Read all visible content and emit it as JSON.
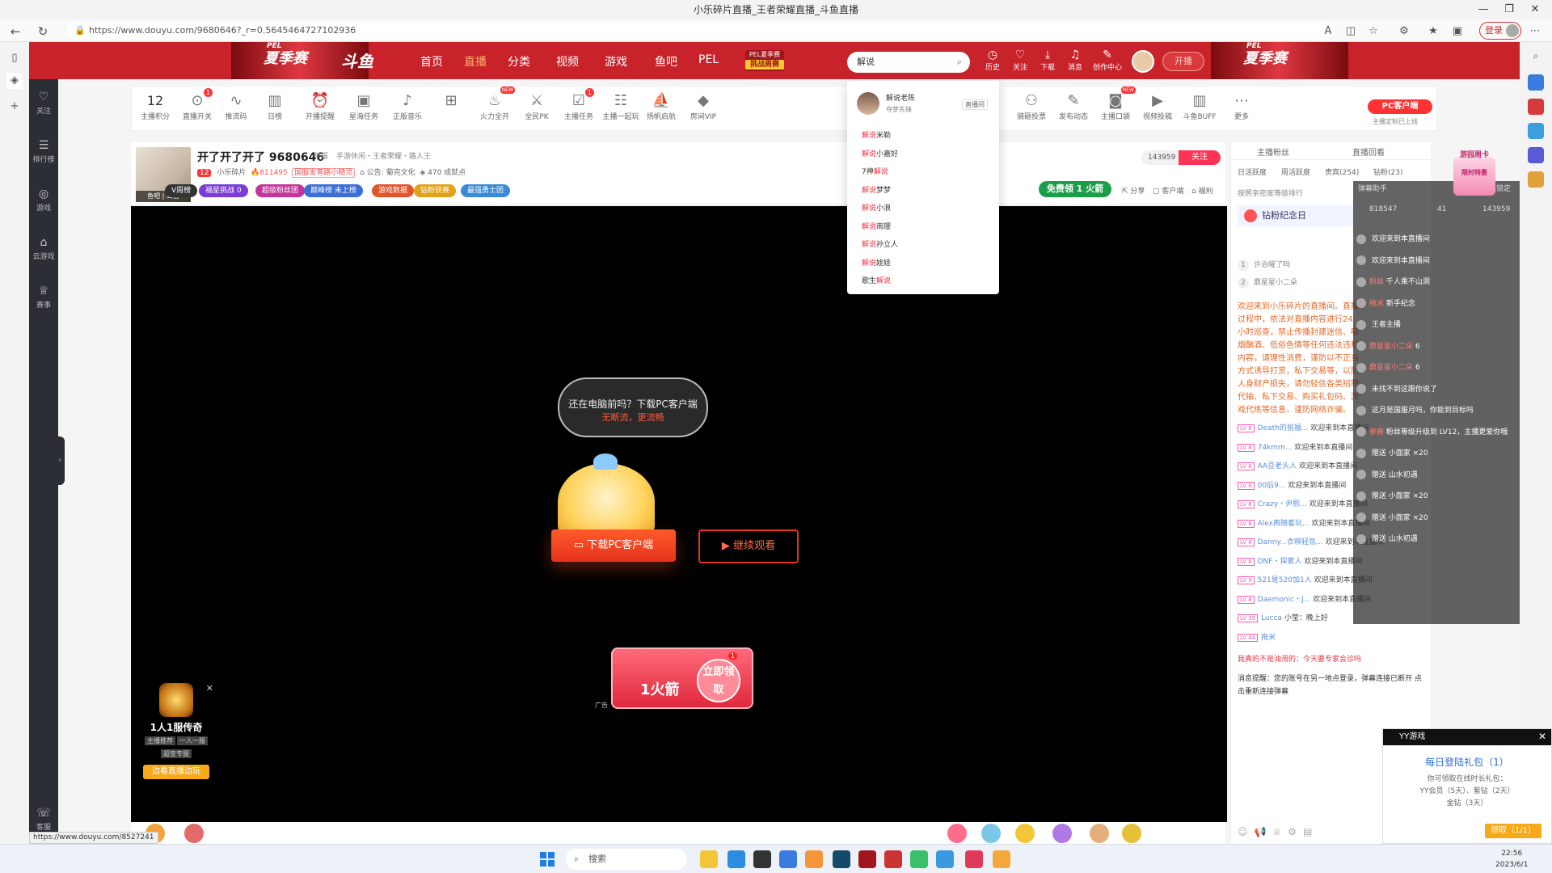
{
  "window": {
    "title": "小乐碎片直播_王者荣耀直播_斗鱼直播",
    "controls": [
      "—",
      "❐",
      "✕"
    ]
  },
  "browser": {
    "url": "https://www.douyu.com/9680646?_r=0.5645464727102936",
    "login_label": "登录",
    "status_url": "https://www.douyu.com/8527241"
  },
  "header": {
    "pel_left": "PEL",
    "pel_left_sub": "夏季赛",
    "pel_right": "PEL",
    "pel_right_sub": "夏季赛",
    "logo": "斗鱼",
    "nav": [
      "首页",
      "直播",
      "分类",
      "视频",
      "游戏",
      "鱼吧",
      "PEL"
    ],
    "pel_badge_top": "PEL夏季赛",
    "pel_badge_bottom": "挑战周赛",
    "search_value": "解说",
    "icons": [
      {
        "label": "历史",
        "icon": "history-icon",
        "glyph": "◷"
      },
      {
        "label": "关注",
        "icon": "heart-icon",
        "glyph": "♡"
      },
      {
        "label": "下载",
        "icon": "download-icon",
        "glyph": "⤓"
      },
      {
        "label": "消息",
        "icon": "bell-icon",
        "glyph": "♫"
      },
      {
        "label": "创作中心",
        "icon": "bulb-icon",
        "glyph": "✎"
      }
    ],
    "start_stream": "开播"
  },
  "dy_sidebar": [
    {
      "label": "关注",
      "glyph": "♡"
    },
    {
      "label": "排行榜",
      "glyph": "☰"
    },
    {
      "label": "游戏",
      "glyph": "◎"
    },
    {
      "label": "云游戏",
      "glyph": "⌂"
    },
    {
      "label": "赛事",
      "glyph": "♕"
    },
    {
      "label": "客服",
      "glyph": "☏"
    }
  ],
  "toolbar": {
    "score": "12",
    "score_label": "主播积分",
    "items": [
      {
        "label": "直播开关",
        "glyph": "⊙",
        "badge": "1"
      },
      {
        "label": "推流码",
        "glyph": "∿"
      },
      {
        "label": "日榜",
        "glyph": "▥"
      },
      {
        "label": "开播提醒",
        "glyph": "⏰"
      },
      {
        "label": "星海任务",
        "glyph": "▣"
      },
      {
        "label": "正版音乐",
        "glyph": "♪"
      },
      {
        "label": "",
        "glyph": "⊞"
      },
      {
        "label": "火力全开",
        "glyph": "♨",
        "new": "NEW"
      },
      {
        "label": "全民PK",
        "glyph": "⚔"
      },
      {
        "label": "主播任务",
        "glyph": "☑",
        "badge": "1"
      },
      {
        "label": "主播一起玩",
        "glyph": "☷"
      },
      {
        "label": "扬帆启航",
        "glyph": "⛵"
      },
      {
        "label": "房间VIP",
        "glyph": "◆"
      }
    ],
    "items_right": [
      {
        "label": "单",
        "glyph": "▦"
      },
      {
        "label": "骑砸投票",
        "glyph": "⚇"
      },
      {
        "label": "发布动态",
        "glyph": "✎"
      },
      {
        "label": "主播口袋",
        "glyph": "◙",
        "new": "NEW"
      },
      {
        "label": "视频投稿",
        "glyph": "▶"
      },
      {
        "label": "斗鱼BUFF",
        "glyph": "▥"
      },
      {
        "label": "更多",
        "glyph": "⋯"
      }
    ],
    "pc_client": "PC客户端",
    "pc_client_sub": "主播定制已上线"
  },
  "room": {
    "title": "开了开了开了 9680646",
    "report": "举报",
    "categories": "手游休闲・王者荣耀・路人王",
    "avatar_caption": "鱼吧 | 公告",
    "level": "12",
    "streamer": "小乐碎片",
    "hot": "811495",
    "help": "国服发育路小精灵",
    "notice": "公告: 菊完文化",
    "fans": "470 成就点",
    "pills": [
      {
        "label": "V周榜",
        "color": "#333333"
      },
      {
        "label": "福星挑战 0",
        "color": "#7a3bd6"
      },
      {
        "label": "超级粉丝团",
        "color": "#c3359a"
      },
      {
        "label": "巅峰榜 未上榜",
        "color": "#3b6fd6"
      },
      {
        "label": "游戏数据",
        "color": "#e0552c"
      },
      {
        "label": "钻粉获赛",
        "color": "#e0a21a"
      },
      {
        "label": "最强勇士团",
        "color": "#3b8ad6"
      }
    ],
    "follow_count": "143959",
    "follow_label": "关注",
    "free_rocket": "免费领 1 火箭",
    "share": "分享",
    "client": "客户端",
    "welfare": "福利"
  },
  "video": {
    "bubble_line1": "还在电脑前吗？下载PC客户端",
    "bubble_line2": "无断流，更流畅",
    "download_btn": "下载PC客户端",
    "watch_btn": "继续观看",
    "rocket_title": "1火箭",
    "rocket_claim": "立即领取",
    "rocket_badge": "1",
    "ad_label": "广告",
    "game_name": "1人1服传奇",
    "game_tags": [
      "主播推荐",
      "一人一服",
      "超变专服"
    ],
    "game_cta": "边看直播边玩"
  },
  "right_panel": {
    "tabs": [
      "主播粉丝",
      "直播回看"
    ],
    "subtabs": [
      "日活跃度",
      "周活跃度",
      "贵宾(254)",
      "钻粉(23)"
    ],
    "notice": "按照亲密度等级排行",
    "diamond": "钻粉纪念日",
    "rank": [
      {
        "n": "1",
        "name": "许治曜了吗"
      },
      {
        "n": "2",
        "name": "鼎星星小二朵"
      }
    ],
    "system_message": "欢迎来到小乐碎片的直播间。直播过程中，依法对直播内容进行24小时巡查，禁止传播封建迷信、吸烟酗酒、低俗色情等任何违法违规内容。请理性消费，谨防以不正当方式诱导打赏，私下交易等，以防人身财产损失，请勿轻信各类招聘代抽、私下交易、购买礼包码、游戏代练等信息，谨防网络诈骗。",
    "chats": [
      {
        "lv": "LV 8",
        "user": "Death的祝福...",
        "text": "欢迎来到本直播间"
      },
      {
        "lv": "LV 8",
        "user": "74kmm...",
        "text": "欢迎来到本直播间"
      },
      {
        "lv": "LV 8",
        "user": "AA豆老头人",
        "text": "欢迎来到本直播间"
      },
      {
        "lv": "LV 8",
        "user": "00后9...",
        "text": "欢迎来到本直播间"
      },
      {
        "lv": "LV 8",
        "user": "Crazy・尹熙...",
        "text": "欢迎来到本直播间"
      },
      {
        "lv": "LV 8",
        "user": "Alex再随着玩...",
        "text": "欢迎来到本直播间"
      },
      {
        "lv": "LV 8",
        "user": "Danny...衣映轻氛...",
        "text": "欢迎来到本直播间"
      },
      {
        "lv": "LV 8",
        "user": "DNF・探索人",
        "text": "欢迎来到本直播间"
      },
      {
        "lv": "LV 9",
        "user": "521是520加1人",
        "text": "欢迎来到本直播间"
      },
      {
        "lv": "LV 8",
        "user": "Daemonic・J...",
        "text": "欢迎来到本直播间"
      },
      {
        "lv": "LV 39",
        "user": "Lucca",
        "text": "小莹：晚上好"
      },
      {
        "lv": "LV 44",
        "user": "拖米",
        "text": ""
      }
    ],
    "plain_line": "我真的不是油滑的：今天要专家会诊吗",
    "warning": "消息提醒：您的账号在另一地点登录，弹幕连接已断开 点击重新连接弹幕"
  },
  "danmu": {
    "header_left": "弹幕助手",
    "header_right": "已锁定",
    "stats": [
      "818547",
      "41",
      "143959"
    ],
    "lines": [
      {
        "name": "",
        "text": "欢迎来到本直播间"
      },
      {
        "name": "",
        "text": "欢迎来到本直播间"
      },
      {
        "name": "粉丝",
        "text": "千人乘不山洞"
      },
      {
        "name": "拖米",
        "text": "新手纪念"
      },
      {
        "name": "",
        "text": "王者主播"
      },
      {
        "name": "鼎星星小二朵",
        "text": "6"
      },
      {
        "name": "鼎星星小二朵",
        "text": "6"
      },
      {
        "name": "",
        "text": "未找不到这跟你说了"
      },
      {
        "name": "",
        "text": "这月是国服月吗，你能到目标吗"
      },
      {
        "name": "参赛",
        "text": "粉丝等级升级到 LV12，主播更爱你哦"
      },
      {
        "name": "",
        "text": "赠送 小面家 ×20"
      },
      {
        "name": "",
        "text": "赠送 山水初遇"
      },
      {
        "name": "",
        "text": "赠送 小面家 ×20"
      },
      {
        "name": "",
        "text": "赠送 小面家 ×20"
      },
      {
        "name": "",
        "text": "赠送 山水初遇"
      }
    ]
  },
  "float_ad": {
    "label": "游园周卡",
    "sub": "限时特惠"
  },
  "yy_popup": {
    "header": "YY游戏",
    "title": "每日登陆礼包（1）",
    "desc_lines": [
      "你可领取在线时长礼包：",
      "YY会员（5天）、紫钻（2天）",
      "金钻（3天）"
    ],
    "claim": "领取（1/1）"
  },
  "search_dropdown": {
    "top_name": "解说老陈",
    "top_sub": "夺梦先锋",
    "top_live": "直播间",
    "items": [
      {
        "pre": "",
        "hl": "解说",
        "post": "米勒"
      },
      {
        "pre": "",
        "hl": "解说",
        "post": "小嘉好"
      },
      {
        "pre": "7神",
        "hl": "解说",
        "post": ""
      },
      {
        "pre": "",
        "hl": "解说",
        "post": "梦梦"
      },
      {
        "pre": "",
        "hl": "解说",
        "post": "小浪"
      },
      {
        "pre": "",
        "hl": "解说",
        "post": "雨璎"
      },
      {
        "pre": "",
        "hl": "解说",
        "post": "孙立人"
      },
      {
        "pre": "",
        "hl": "解说",
        "post": "娃娃"
      },
      {
        "pre": "歌生",
        "hl": "解说",
        "post": ""
      }
    ]
  },
  "taskbar": {
    "search": "搜索",
    "time": "22:56",
    "date": "2023/6/1"
  }
}
